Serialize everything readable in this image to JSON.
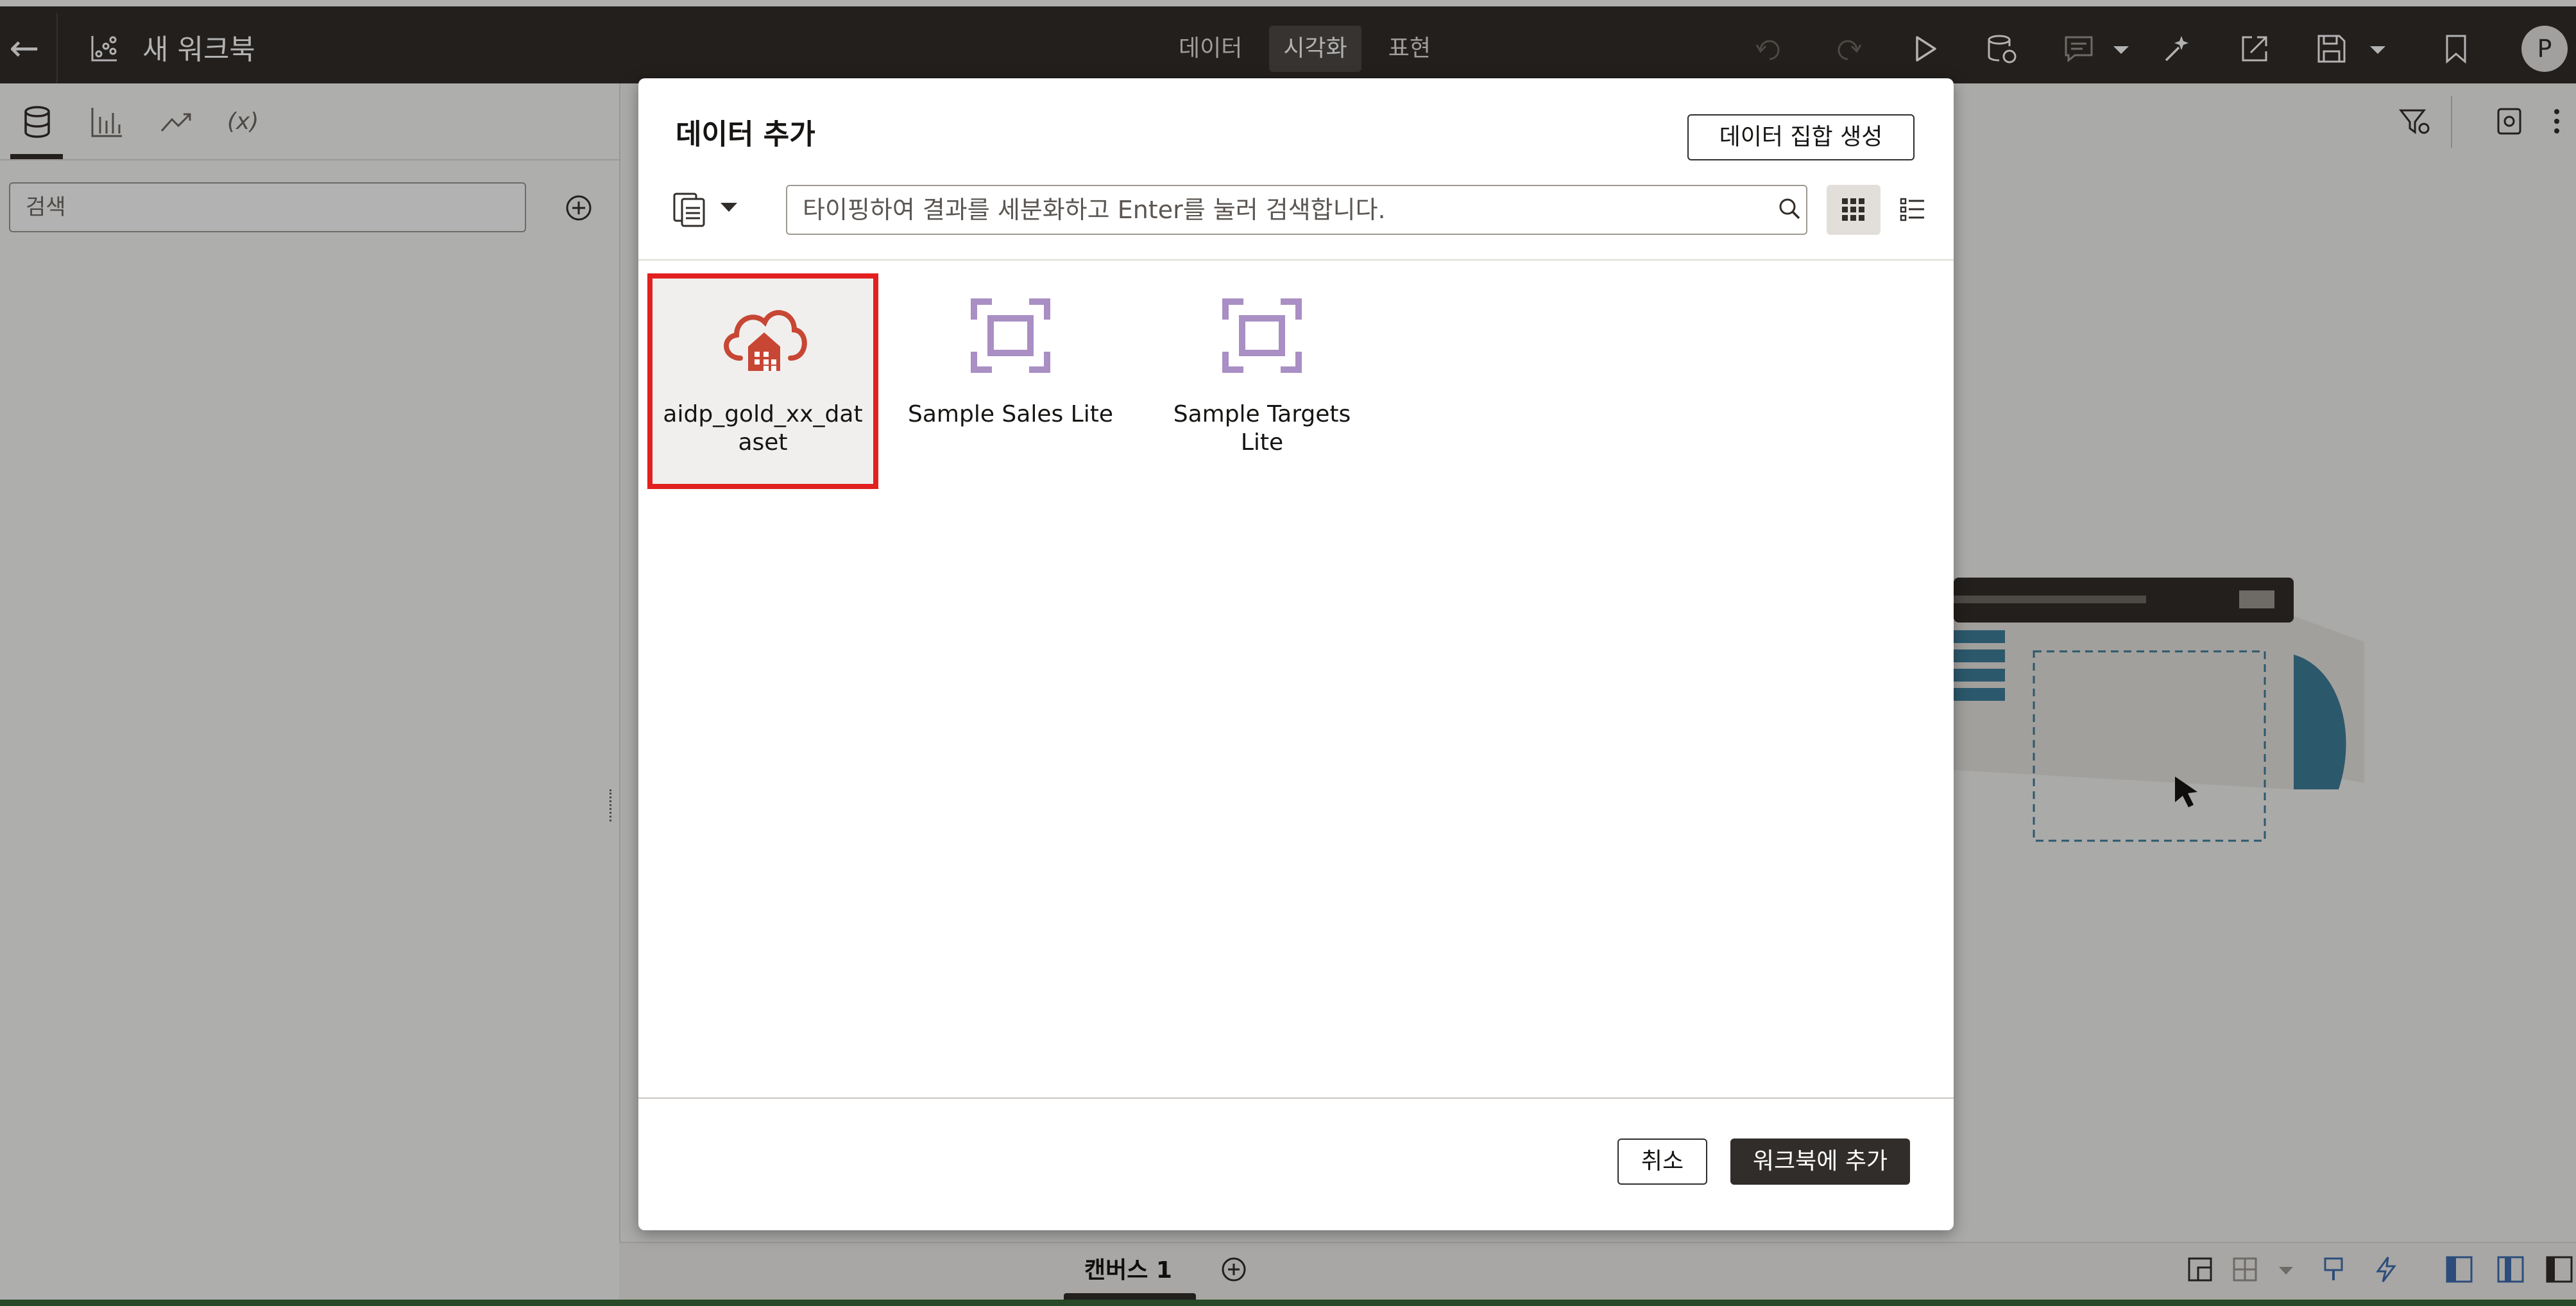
{
  "topbar": {
    "back_label": "←",
    "workbook_title": "새 워크북",
    "tabs": [
      {
        "label": "데이터",
        "active": false
      },
      {
        "label": "시각화",
        "active": true
      },
      {
        "label": "표현",
        "active": false
      }
    ],
    "avatar_initial": "P",
    "icons": [
      "undo-icon",
      "redo-icon",
      "play-icon",
      "data-refresh-icon",
      "comment-icon",
      "auto-insights-icon",
      "export-icon",
      "save-icon",
      "bookmark-icon"
    ]
  },
  "left_panel": {
    "tabs": [
      "data-icon",
      "visualizations-icon",
      "analytics-icon",
      "variables-icon"
    ],
    "variables_label": "(x)",
    "search_placeholder": "검색"
  },
  "canvas": {
    "tab_label": "캔버스 1"
  },
  "dialog": {
    "title": "데이터 추가",
    "create_dataset_label": "데이터 집합 생성",
    "search_placeholder": "타이핑하여 결과를 세분화하고 Enter를 눌러 검색합니다.",
    "view_mode": "grid",
    "items": [
      {
        "label": "aidp_gold_xx_dat aset",
        "icon": "cloud-warehouse-icon",
        "selected": true
      },
      {
        "label": "Sample Sales Lite",
        "icon": "dataset-frame-icon",
        "selected": false
      },
      {
        "label": "Sample Targets Lite",
        "icon": "dataset-frame-icon",
        "selected": false
      }
    ],
    "cancel_label": "취소",
    "add_label": "워크북에 추가"
  },
  "colors": {
    "topbar": "#312d2a",
    "selection_border": "#e22020",
    "cloud_icon": "#c74634",
    "dataset_icon": "#a98fc4",
    "primary_button": "#312d2a"
  }
}
